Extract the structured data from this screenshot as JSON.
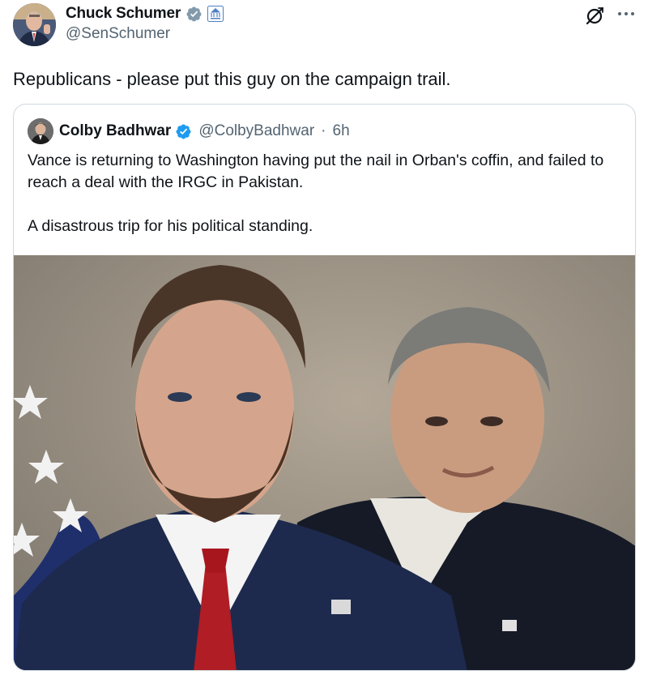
{
  "tweet": {
    "author": {
      "display_name": "Chuck Schumer",
      "handle": "@SenSchumer",
      "avatar_icon": "profile-photo",
      "verified_icon": "verified-gray-badge-icon",
      "affiliation_icon": "us-senate-badge-icon"
    },
    "text": "Republicans - please put this guy on the campaign trail.",
    "actions": {
      "grok_icon": "grok-icon",
      "more_icon": "more-options-icon"
    }
  },
  "quoted_tweet": {
    "author": {
      "display_name": "Colby Badhwar",
      "handle": "@ColbyBadhwar",
      "verified_icon": "verified-blue-badge-icon"
    },
    "separator": "·",
    "time": "6h",
    "text": "Vance is returning to Washington having put the nail in Orban's coffin, and failed to reach a deal with the IRGC in Pakistan.\n\nA disastrous trip for his political standing.",
    "media": {
      "type": "photo"
    }
  },
  "colors": {
    "text_primary": "#0f1419",
    "text_secondary": "#536471",
    "border": "#cfd9de",
    "verified_blue": "#1d9bf0",
    "verified_gray": "#829aab"
  }
}
